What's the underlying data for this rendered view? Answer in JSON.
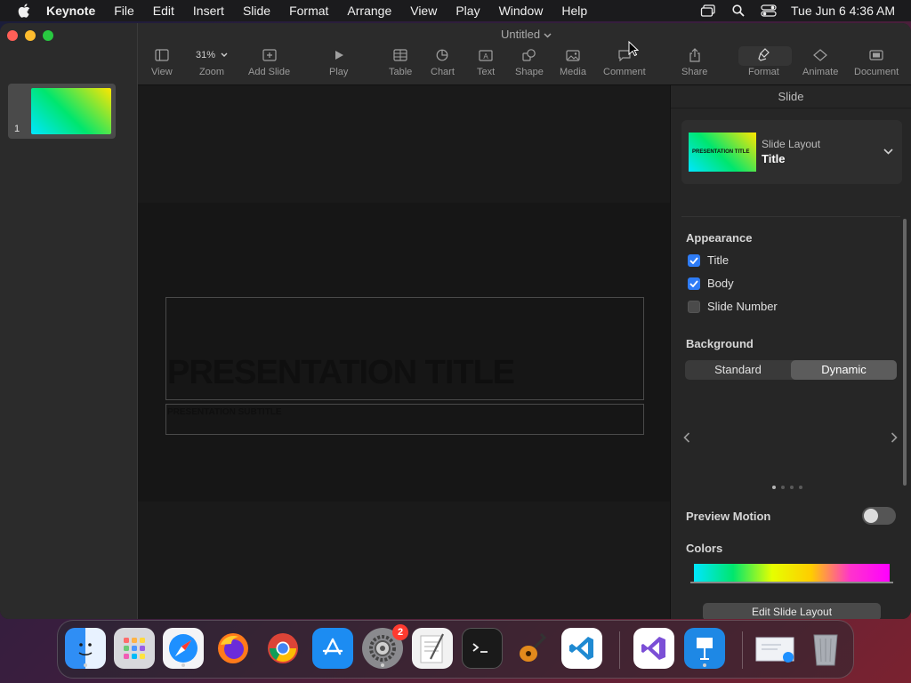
{
  "menubar": {
    "app": "Keynote",
    "items": [
      "File",
      "Edit",
      "Insert",
      "Slide",
      "Format",
      "Arrange",
      "View",
      "Play",
      "Window",
      "Help"
    ],
    "clock": "Tue Jun 6  4:36 AM"
  },
  "document": {
    "title": "Untitled"
  },
  "toolbar": {
    "view": "View",
    "zoom_value": "31%",
    "zoom": "Zoom",
    "add_slide": "Add Slide",
    "play": "Play",
    "table": "Table",
    "chart": "Chart",
    "text": "Text",
    "shape": "Shape",
    "media": "Media",
    "comment": "Comment",
    "share": "Share",
    "format": "Format",
    "animate": "Animate",
    "document": "Document"
  },
  "sidebar": {
    "slide_number": "1"
  },
  "slide": {
    "title": "PRESENTATION TITLE",
    "subtitle": "PRESENTATION SUBTITLE"
  },
  "inspector": {
    "header": "Slide",
    "layout_label": "Slide Layout",
    "layout_value": "Title",
    "layout_thumb_text": "PRESENTATION TITLE",
    "appearance": "Appearance",
    "checks": [
      {
        "label": "Title",
        "checked": true
      },
      {
        "label": "Body",
        "checked": true
      },
      {
        "label": "Slide Number",
        "checked": false
      }
    ],
    "background": "Background",
    "seg_standard": "Standard",
    "seg_dynamic": "Dynamic",
    "preview_motion": "Preview Motion",
    "colors": "Colors",
    "edit_layout": "Edit Slide Layout"
  },
  "dock": {
    "settings_badge": "2"
  },
  "colors": {
    "accent": "#2e7cf6",
    "close": "#ff5f57",
    "minimize": "#febc2e",
    "zoom": "#28c840"
  }
}
